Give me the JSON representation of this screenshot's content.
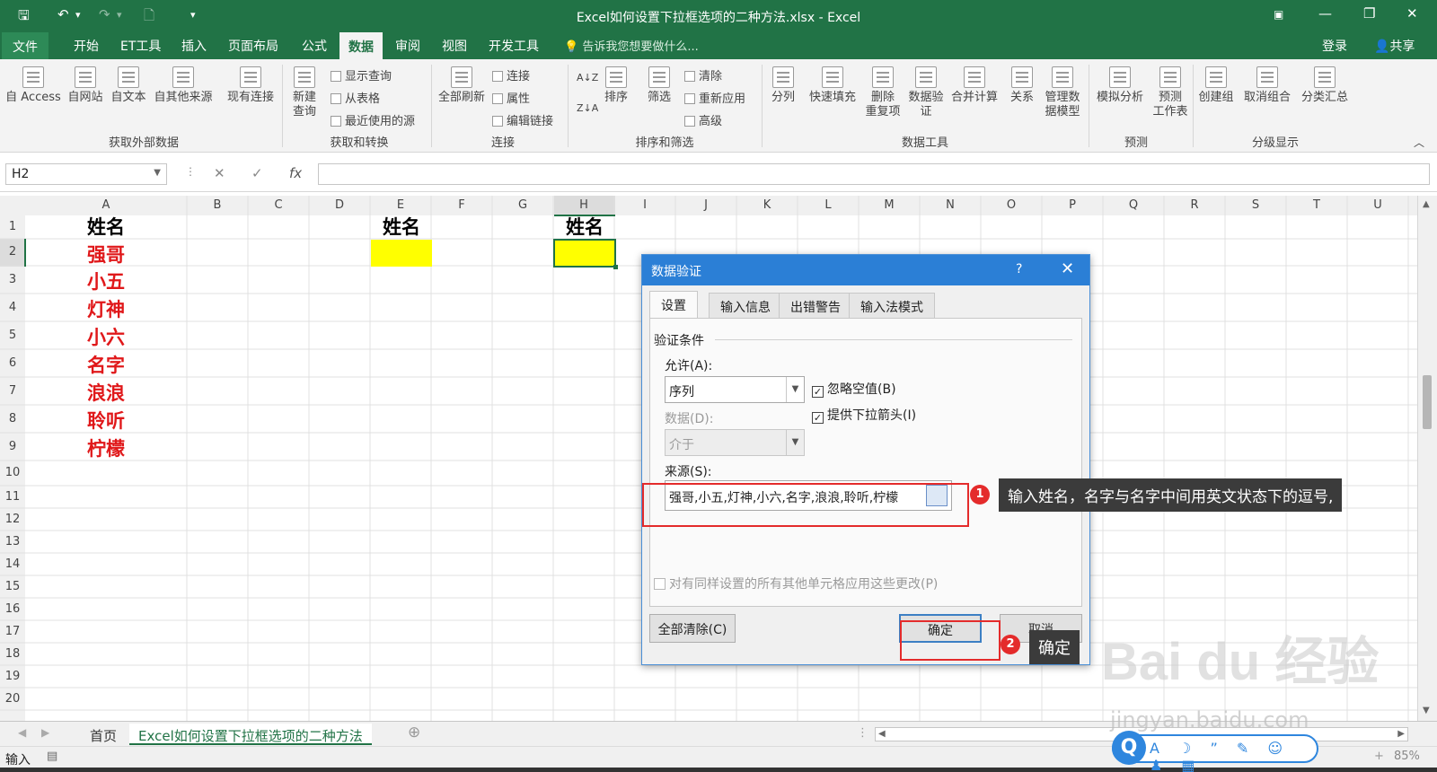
{
  "window": {
    "title": "Excel如何设置下拉框选项的二种方法.xlsx - Excel",
    "controls": {
      "restore_ribbon": "▣",
      "minimize": "—",
      "maximize": "❐",
      "close": "✕"
    }
  },
  "quick_access": {
    "save": "🖫",
    "undo": "↶",
    "undo_dd": "▾",
    "redo": "↷",
    "redo_dd": "▾",
    "new": "🗋",
    "customize": "▾"
  },
  "menu_tabs": [
    "文件",
    "开始",
    "ET工具",
    "插入",
    "页面布局",
    "公式",
    "数据",
    "审阅",
    "视图",
    "开发工具"
  ],
  "active_tab": "数据",
  "tell_me": "告诉我您想要做什么...",
  "account": {
    "login": "登录",
    "share": "共享"
  },
  "ribbon": {
    "get_external": {
      "label": "获取外部数据",
      "buttons": [
        "自 Access",
        "自网站",
        "自文本",
        "自其他来源",
        "现有连接"
      ]
    },
    "get_transform": {
      "label": "获取和转换",
      "big": [
        "新建",
        "查询"
      ],
      "small": [
        "显示查询",
        "从表格",
        "最近使用的源"
      ]
    },
    "connections": {
      "label": "连接",
      "big": "全部刷新",
      "small": [
        "连接",
        "属性",
        "编辑链接"
      ]
    },
    "sort_filter": {
      "label": "排序和筛选",
      "sort": "排序",
      "filter": "筛选",
      "small": [
        "清除",
        "重新应用",
        "高级"
      ],
      "az": "A↓Z",
      "za": "Z↓A"
    },
    "data_tools": {
      "label": "数据工具",
      "buttons": [
        "分列",
        "快速填充",
        "删除\n重复项",
        "数据验\n证",
        "合并计算",
        "关系",
        "管理数\n据模型"
      ]
    },
    "forecast": {
      "label": "预测",
      "buttons": [
        "模拟分析",
        "预测\n工作表"
      ]
    },
    "outline": {
      "label": "分级显示",
      "buttons": [
        "创建组",
        "取消组合",
        "分类汇总"
      ]
    }
  },
  "formula_bar": {
    "name_box": "H2",
    "cancel": "✕",
    "enter": "✓",
    "fx": "fx",
    "formula": ""
  },
  "columns": [
    "A",
    "B",
    "C",
    "D",
    "E",
    "F",
    "G",
    "H",
    "I",
    "J",
    "K",
    "L",
    "M",
    "N",
    "O",
    "P",
    "Q",
    "R",
    "S",
    "T",
    "U"
  ],
  "rows": [
    "1",
    "2",
    "3",
    "4",
    "5",
    "6",
    "7",
    "8",
    "9",
    "10",
    "11",
    "12",
    "13",
    "14",
    "15",
    "16",
    "17",
    "18",
    "19",
    "20"
  ],
  "cells": {
    "A1": "姓名",
    "E1": "姓名",
    "H1": "姓名",
    "A_names": [
      "强哥",
      "小五",
      "灯神",
      "小六",
      "名字",
      "浪浪",
      "聆听",
      "柠檬"
    ]
  },
  "highlight_color": "#ffff00",
  "sheet_tabs": [
    "首页",
    "Excel如何设置下拉框选项的二种方法"
  ],
  "active_sheet": "Excel如何设置下拉框选项的二种方法",
  "add_sheet": "⊕",
  "status": {
    "mode": "输入",
    "zoom": "85%"
  },
  "dialog": {
    "title": "数据验证",
    "help": "?",
    "close": "✕",
    "tabs": [
      "设置",
      "输入信息",
      "出错警告",
      "输入法模式"
    ],
    "section": "验证条件",
    "allow_label": "允许(A):",
    "allow_value": "序列",
    "data_label": "数据(D):",
    "data_value": "介于",
    "ignore_blank": "忽略空值(B)",
    "dropdown_arrow": "提供下拉箭头(I)",
    "source_label": "来源(S):",
    "source_value": "强哥,小五,灯神,小六,名字,浪浪,聆听,柠檬",
    "apply_all": "对有同样设置的所有其他单元格应用这些更改(P)",
    "clear_all": "全部清除(C)",
    "ok": "确定",
    "cancel": "取消"
  },
  "annotations": {
    "badge1": "1",
    "callout1": "输入姓名，名字与名字中间用英文状态下的逗号,",
    "badge2": "2",
    "callout2": "确定"
  },
  "watermark": {
    "text": "Bai du 经验",
    "url": "jingyan.baidu.com"
  },
  "ime": {
    "q": "Q",
    "icons": "A ☽ ” ✎ ☺ ♟ ▦"
  },
  "colors": {
    "excel_green": "#217346",
    "red_text": "#e0181a",
    "dialog_blue": "#2b7fd6",
    "annotation_red": "#e42b2b"
  }
}
